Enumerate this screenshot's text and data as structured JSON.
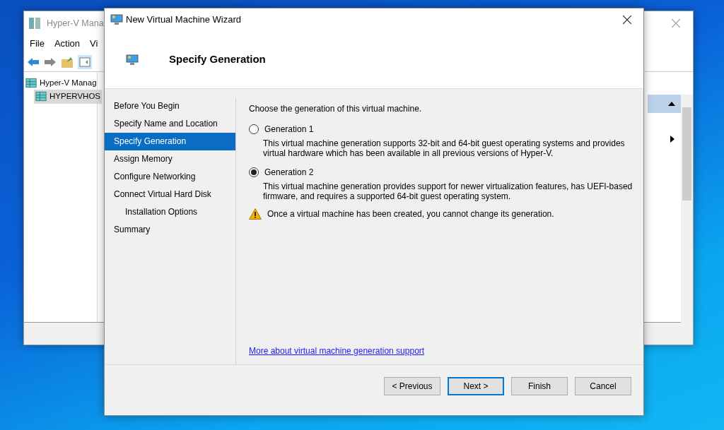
{
  "background_window": {
    "title": "Hyper-V Mana",
    "menu": [
      {
        "label": "File"
      },
      {
        "label": "Action"
      },
      {
        "label": "Vi"
      }
    ],
    "tree": [
      {
        "label": "Hyper-V Manag",
        "selected": false,
        "children": [
          {
            "label": "HYPERVHOS",
            "selected": true
          }
        ]
      }
    ]
  },
  "wizard": {
    "title": "New Virtual Machine Wizard",
    "heading": "Specify Generation",
    "steps": [
      {
        "label": "Before You Begin",
        "selected": false
      },
      {
        "label": "Specify Name and Location",
        "selected": false
      },
      {
        "label": "Specify Generation",
        "selected": true
      },
      {
        "label": "Assign Memory",
        "selected": false
      },
      {
        "label": "Configure Networking",
        "selected": false
      },
      {
        "label": "Connect Virtual Hard Disk",
        "selected": false,
        "children": [
          {
            "label": "Installation Options",
            "selected": false
          }
        ]
      },
      {
        "label": "Summary",
        "selected": false
      }
    ],
    "prompt": "Choose the generation of this virtual machine.",
    "options": [
      {
        "label": "Generation 1",
        "selected": false,
        "description": "This virtual machine generation supports 32-bit and 64-bit guest operating systems and provides virtual hardware which has been available in all previous versions of Hyper-V."
      },
      {
        "label": "Generation 2",
        "selected": true,
        "description": "This virtual machine generation provides support for newer virtualization features, has UEFI-based firmware, and requires a supported 64-bit guest operating system."
      }
    ],
    "warning": "Once a virtual machine has been created, you cannot change its generation.",
    "link": "More about virtual machine generation support",
    "buttons": [
      {
        "label": "< Previous",
        "default": false
      },
      {
        "label": "Next >",
        "default": true
      },
      {
        "label": "Finish",
        "default": false
      },
      {
        "label": "Cancel",
        "default": false
      }
    ]
  }
}
